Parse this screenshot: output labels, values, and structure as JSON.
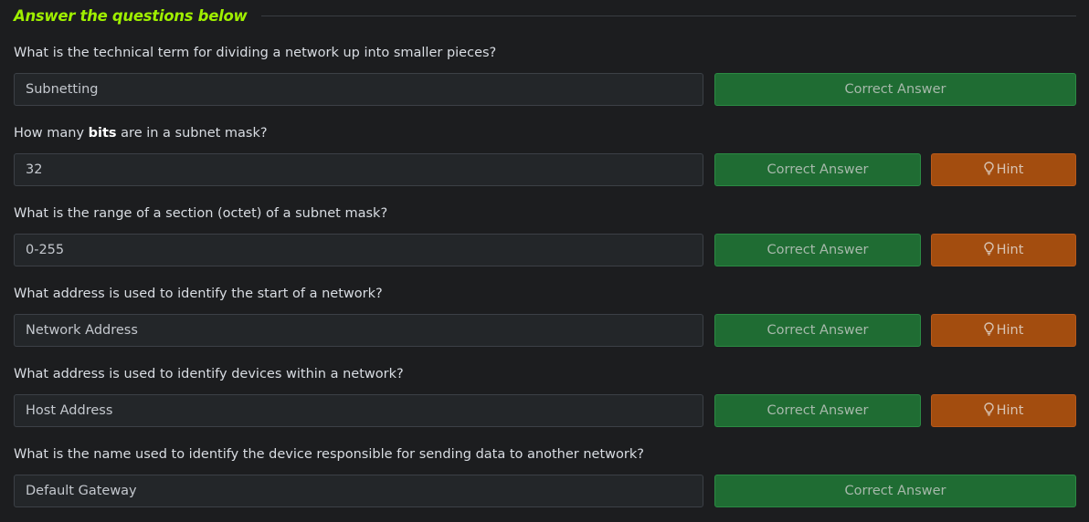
{
  "section": {
    "title": "Answer the questions below"
  },
  "questions": [
    {
      "text": "What is the technical term for dividing a network up into smaller pieces?",
      "answer": "Subnetting",
      "correct_label": "Correct Answer"
    },
    {
      "text_before": "How many ",
      "text_bold": "bits",
      "text_after": " are in a subnet mask?",
      "answer": "32",
      "correct_label": "Correct Answer",
      "hint_label": "Hint"
    },
    {
      "text": "What is the range of a section (octet) of a subnet mask?",
      "answer": "0-255",
      "correct_label": "Correct Answer",
      "hint_label": "Hint"
    },
    {
      "text": "What address is used to identify the start of a network?",
      "answer": "Network Address",
      "correct_label": "Correct Answer",
      "hint_label": "Hint"
    },
    {
      "text": "What address is used to identify devices within a network?",
      "answer": "Host Address",
      "correct_label": "Correct Answer",
      "hint_label": "Hint"
    },
    {
      "text": "What is the name used to identify the device responsible for sending data to another network?",
      "answer": "Default Gateway",
      "correct_label": "Correct Answer"
    }
  ],
  "icons": {
    "hint": "lightbulb-icon"
  },
  "colors": {
    "accent": "#9fef00",
    "correct": "#1f6c33",
    "hint": "#a34d0f",
    "background": "#1c1d1f",
    "input": "#232629"
  }
}
